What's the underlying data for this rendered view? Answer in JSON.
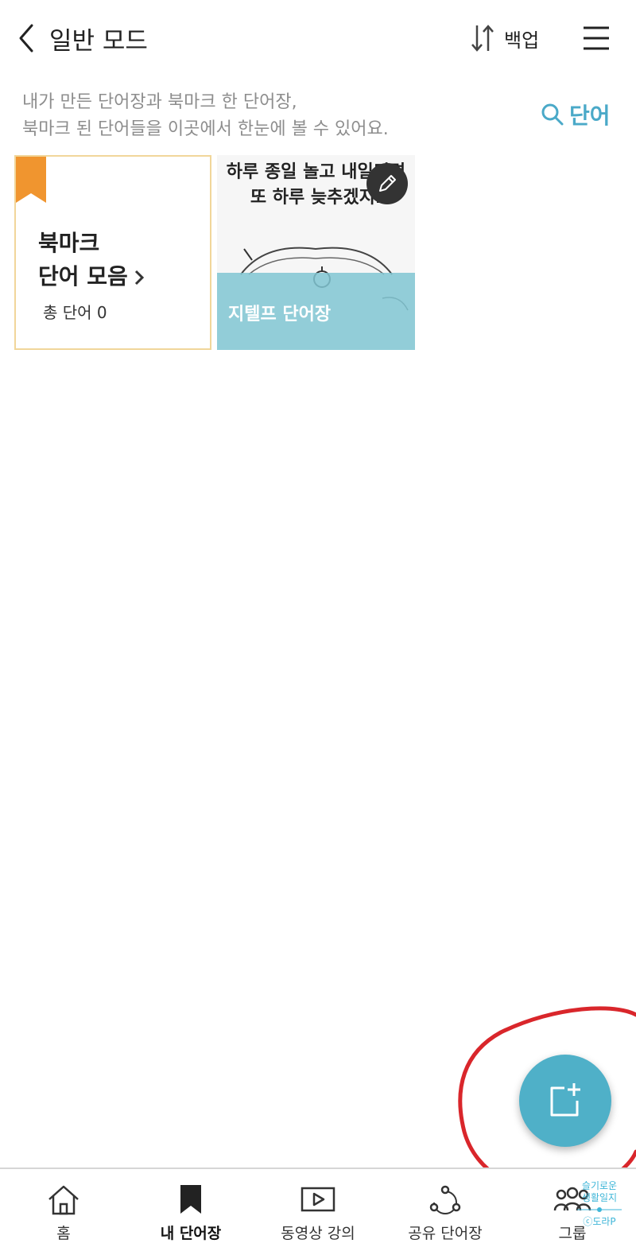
{
  "header": {
    "title": "일반 모드",
    "sort_label": "백업",
    "icons": {
      "back": "back-arrow-icon",
      "sort": "sort-arrows-icon",
      "menu": "hamburger-menu-icon"
    }
  },
  "description": {
    "line1": "내가 만든 단어장과 북마크 한 단어장,",
    "line2": "북마크 된 단어들을 이곳에서 한눈에 볼 수 있어요."
  },
  "word_search": {
    "label": "단어",
    "icon": "search-icon"
  },
  "bookmark_card": {
    "title_line1": "북마크",
    "title_line2": "단어 모음",
    "count_text": "총 단어 0",
    "ribbon_color": "#f0952f"
  },
  "vocab_card": {
    "name": "지텔프 단어장",
    "cover_caption_line1": "하루 종일 놀고 내일되면",
    "cover_caption_line2": "또 하루 늦추겠지.",
    "band_color": "#80c5d2"
  },
  "fab": {
    "icon": "add-note-icon",
    "color": "#4fb0c8"
  },
  "annotation": {
    "color": "#d9262b"
  },
  "bottom_nav": {
    "items": [
      {
        "label": "홈",
        "icon": "home-icon",
        "active": false
      },
      {
        "label": "내 단어장",
        "icon": "bookmark-icon",
        "active": true
      },
      {
        "label": "동영상 강의",
        "icon": "video-play-icon",
        "active": false
      },
      {
        "label": "공유 단어장",
        "icon": "share-icon",
        "active": false
      },
      {
        "label": "그룹",
        "icon": "group-icon",
        "active": false
      }
    ]
  },
  "watermark": {
    "line1": "슬기로운",
    "line2": "생활일지",
    "line3": "ⓒ도라P"
  }
}
